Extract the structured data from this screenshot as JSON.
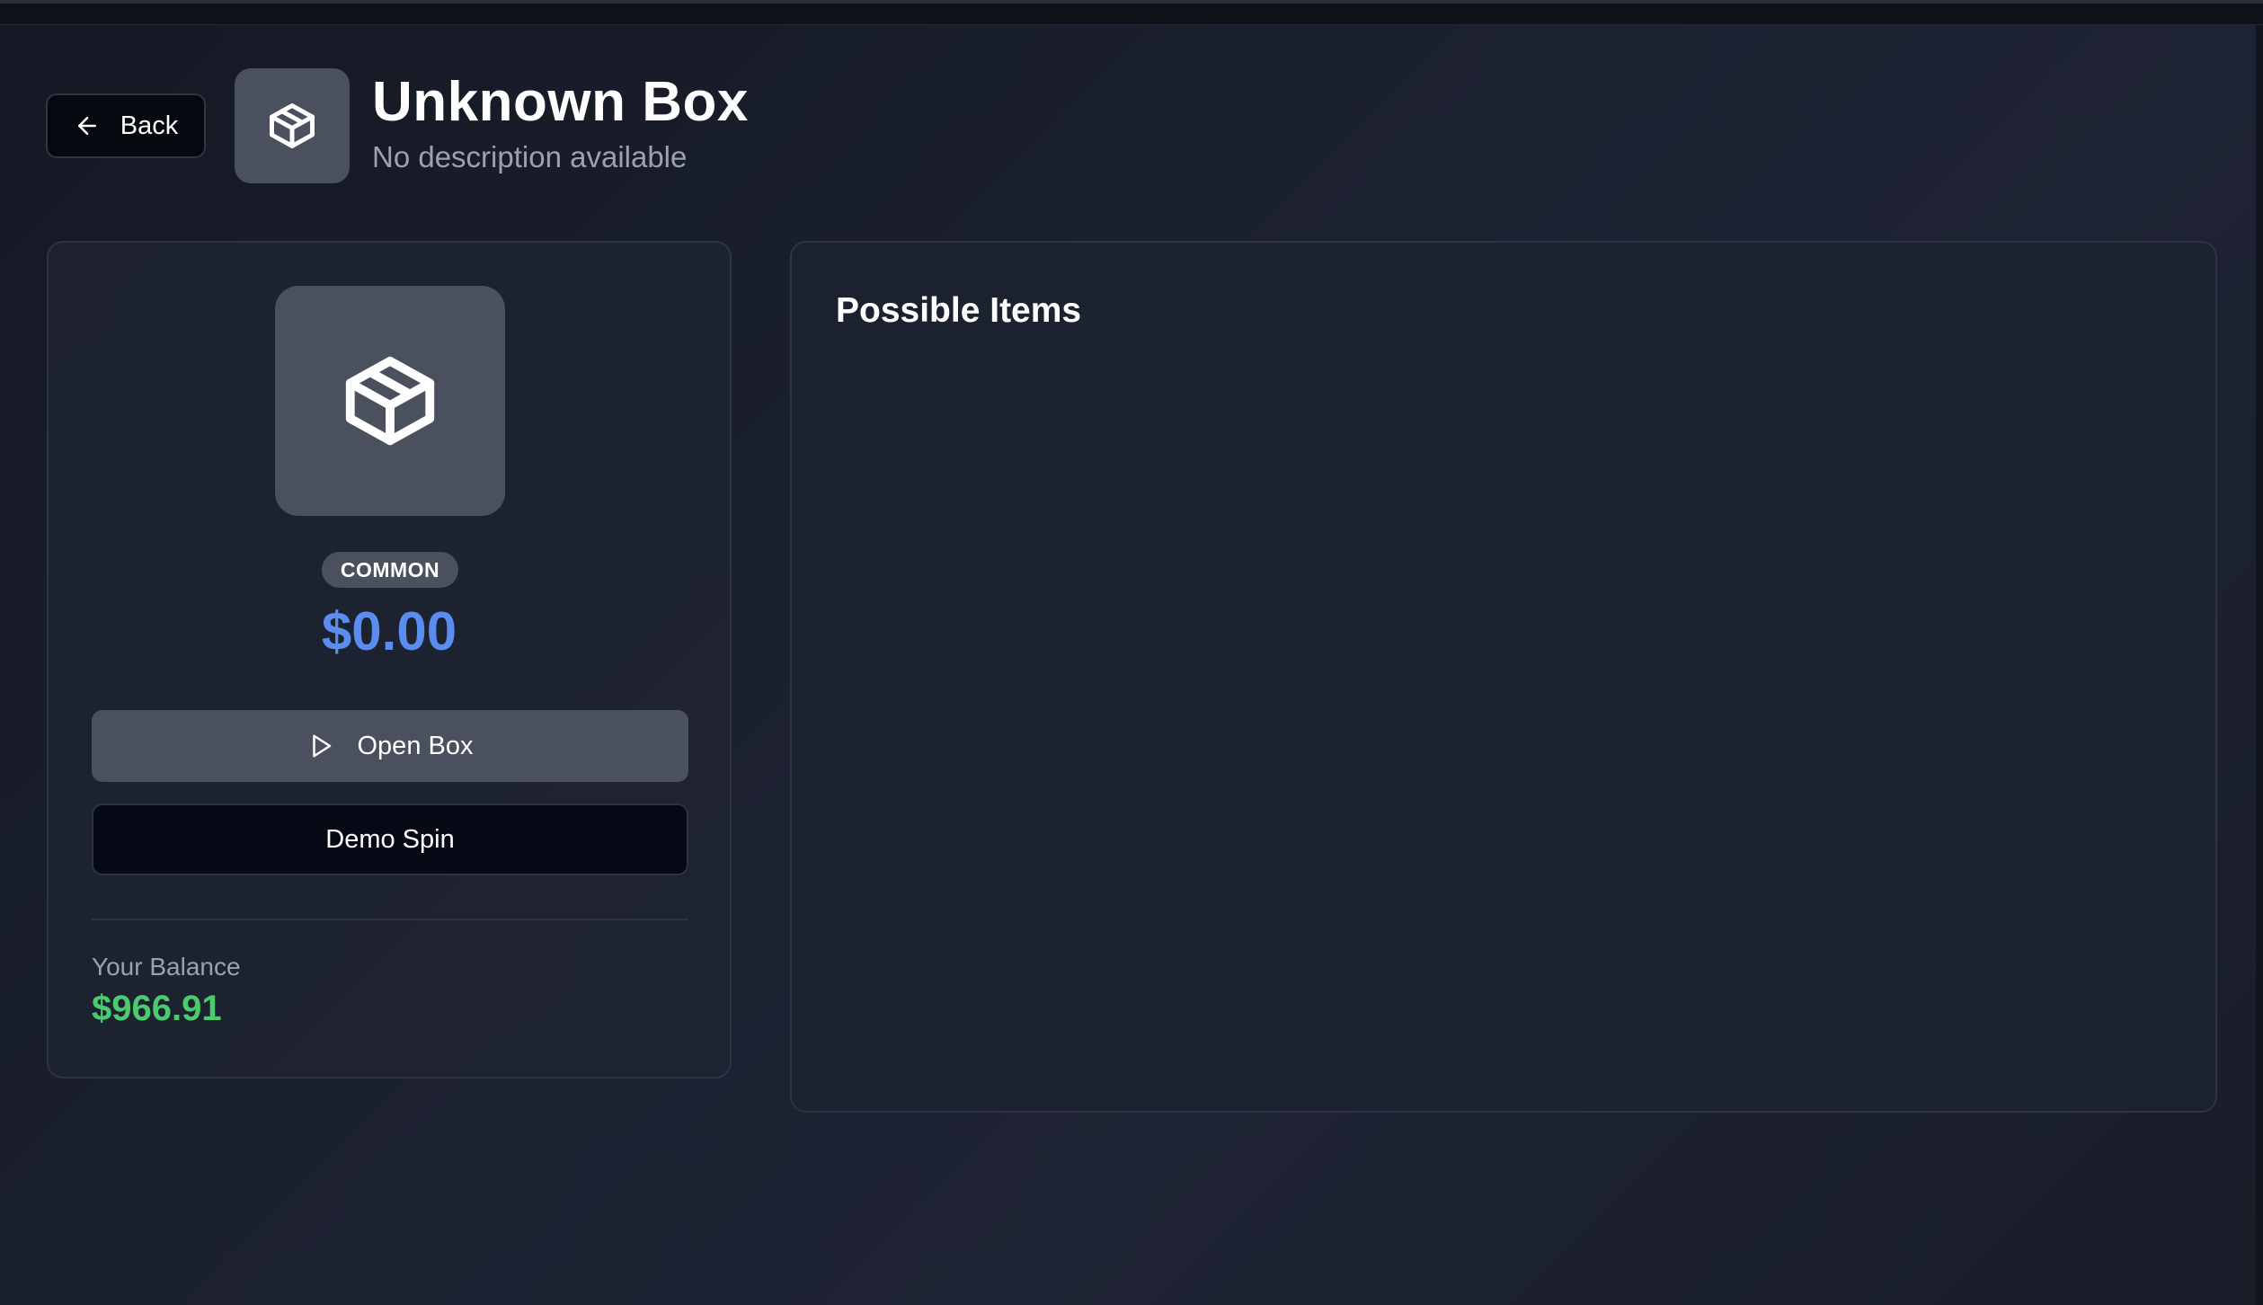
{
  "header": {
    "back_label": "Back",
    "title": "Unknown Box",
    "subtitle": "No description available",
    "icon": "package-icon"
  },
  "box": {
    "icon": "package-icon",
    "rarity": "COMMON",
    "price": "$0.00",
    "open_label": "Open Box",
    "demo_label": "Demo Spin",
    "balance_label": "Your Balance",
    "balance_value": "$966.91"
  },
  "items_panel": {
    "title": "Possible Items"
  },
  "colors": {
    "background": "#1c2130",
    "card": "#1e2331",
    "icon_tile": "#4a505d",
    "price_accent": "#5b8cf0",
    "balance_accent": "#4ccb6e",
    "muted_text": "#9ba1ad"
  }
}
